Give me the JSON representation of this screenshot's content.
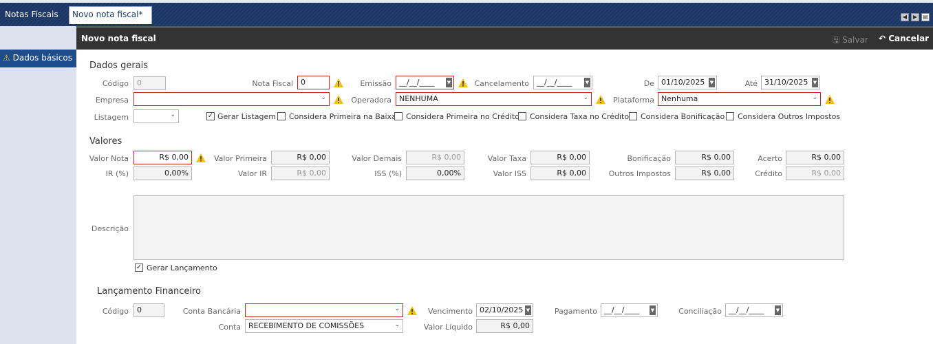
{
  "tabs": {
    "main": "Notas Fiscais",
    "active": "Novo nota fiscal*"
  },
  "sidebar": {
    "item": "Dados básicos"
  },
  "panel": {
    "title": "Novo nota fiscal",
    "save": "Salvar",
    "cancel": "Cancelar"
  },
  "sections": {
    "dados_gerais": "Dados gerais",
    "valores": "Valores",
    "lancamento": "Lançamento Financeiro"
  },
  "dados_gerais": {
    "codigo_label": "Código",
    "codigo_value": "0",
    "nota_label": "Nota Fiscal",
    "nota_value": "0",
    "emissao_label": "Emissão",
    "emissao_value": "__/__/____",
    "cancelamento_label": "Cancelamento",
    "cancelamento_value": "__/__/____",
    "de_label": "De",
    "de_value": "01/10/2025",
    "ate_label": "Até",
    "ate_value": "31/10/2025",
    "empresa_label": "Empresa",
    "empresa_value": "",
    "operadora_label": "Operadora",
    "operadora_value": "NENHUMA",
    "plataforma_label": "Plataforma",
    "plataforma_value": "Nenhuma",
    "listagem_label": "Listagem",
    "listagem_value": "",
    "checks": [
      {
        "label": "Gerar Listagem",
        "checked": true
      },
      {
        "label": "Considera Primeira na Baixa",
        "checked": false
      },
      {
        "label": "Considera Primeira no Crédito",
        "checked": false
      },
      {
        "label": "Considera Taxa no Crédito",
        "checked": false
      },
      {
        "label": "Considera Bonificação",
        "checked": false
      },
      {
        "label": "Considera Outros Impostos",
        "checked": false
      }
    ]
  },
  "valores": {
    "valor_nota_label": "Valor Nota",
    "valor_nota": "R$ 0,00",
    "valor_primeira_label": "Valor Primeira",
    "valor_primeira": "R$ 0,00",
    "valor_demais_label": "Valor Demais",
    "valor_demais": "R$ 0,00",
    "valor_taxa_label": "Valor Taxa",
    "valor_taxa": "R$ 0,00",
    "bonificacao_label": "Bonificação",
    "bonificacao": "R$ 0,00",
    "acerto_label": "Acerto",
    "acerto": "R$ 0,00",
    "ir_label": "IR (%)",
    "ir": "0,00%",
    "valor_ir_label": "Valor IR",
    "valor_ir": "R$ 0,00",
    "iss_label": "ISS (%)",
    "iss": "0,00%",
    "valor_iss_label": "Valor ISS",
    "valor_iss": "R$ 0,00",
    "outros_label": "Outros Impostos",
    "outros": "R$ 0,00",
    "credito_label": "Crédito",
    "credito": "R$ 0,00",
    "descricao_label": "Descrição",
    "descricao": "",
    "gerar_lancamento_label": "Gerar Lançamento"
  },
  "lancamento": {
    "codigo_label": "Código",
    "codigo_value": "0",
    "conta_bancaria_label": "Conta Bancária",
    "conta_bancaria_value": "",
    "vencimento_label": "Vencimento",
    "vencimento_value": "02/10/2025",
    "pagamento_label": "Pagamento",
    "pagamento_value": "__/__/____",
    "conciliacao_label": "Conciliação",
    "conciliacao_value": "__/__/____",
    "conta_label": "Conta",
    "conta_value": "RECEBIMENTO DE COMISSÕES",
    "valor_liquido_label": "Valor Líquido",
    "valor_liquido": "R$ 0,00"
  },
  "colors": {
    "error": "#d21f1f",
    "warning": "#f5c400",
    "header": "#333333",
    "sidebar_active": "#1e4c8c"
  }
}
